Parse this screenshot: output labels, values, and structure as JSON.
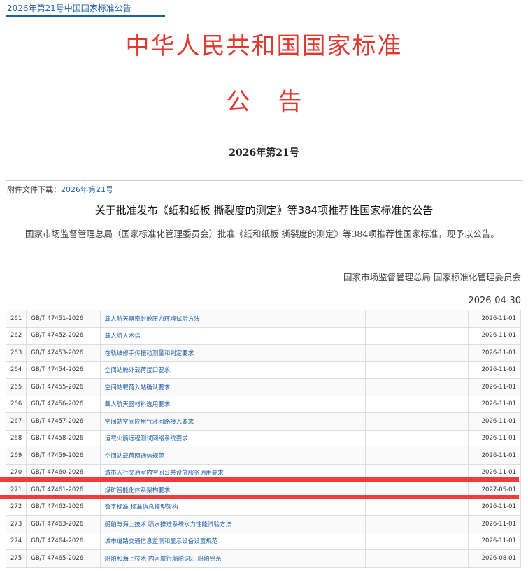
{
  "breadcrumb": "2026年第21号中国国家标准公告",
  "header": {
    "title": "中华人民共和国国家标准",
    "subtitle": "公告",
    "issue": "2026年第21号"
  },
  "attachment": {
    "label": "附件文件下载：",
    "link": "2026年第21号"
  },
  "notice": {
    "title": "关于批准发布《纸和纸板 撕裂度的测定》等384项推荐性国家标准的公告",
    "body": "国家市场监督管理总局（国家标准化管理委员会）批准《纸和纸板 撕裂度的测定》等384项推荐性国家标准，现予以公告。",
    "signature": "国家市场监督管理总局 国家标准化管理委员会",
    "date": "2026-04-30"
  },
  "rows": [
    {
      "num": "261",
      "code": "GB/T 47451-2026",
      "name": "载人航天器密封舱压力环境试验方法",
      "date": "2026-11-01"
    },
    {
      "num": "262",
      "code": "GB/T 47452-2026",
      "name": "载人航天术语",
      "date": "2026-11-01"
    },
    {
      "num": "263",
      "code": "GB/T 47453-2026",
      "name": "在轨维修手传振动测量和判定要求",
      "date": "2026-11-01"
    },
    {
      "num": "264",
      "code": "GB/T 47454-2026",
      "name": "空间站舱外载荷接口要求",
      "date": "2026-11-01"
    },
    {
      "num": "265",
      "code": "GB/T 47455-2026",
      "name": "空间站载荷入站确认要求",
      "date": "2026-11-01"
    },
    {
      "num": "266",
      "code": "GB/T 47456-2026",
      "name": "载人航天器材料选用要求",
      "date": "2026-11-01"
    },
    {
      "num": "267",
      "code": "GB/T 47457-2026",
      "name": "空间站空间应用气液回路接入要求",
      "date": "2026-11-01"
    },
    {
      "num": "268",
      "code": "GB/T 47458-2026",
      "name": "运载火箭远程测试网络系统要求",
      "date": "2026-11-01"
    },
    {
      "num": "269",
      "code": "GB/T 47459-2026",
      "name": "空间站载荷网通信规范",
      "date": "2026-11-01"
    },
    {
      "num": "270",
      "code": "GB/T 47460-2026",
      "name": "城市人行交通室内空间公共设施服务通用要求",
      "date": "2026-11-01"
    },
    {
      "num": "271",
      "code": "GB/T 47461-2026",
      "name": "煤矿智能化体系架构要求",
      "date": "2027-05-01"
    },
    {
      "num": "272",
      "code": "GB/T 47462-2026",
      "name": "数字标准 标准信息模型架构",
      "date": "2026-11-01"
    },
    {
      "num": "273",
      "code": "GB/T 47463-2026",
      "name": "船舶与海上技术 喷水推进系统水力性能试验方法",
      "date": "2026-11-01"
    },
    {
      "num": "274",
      "code": "GB/T 47464-2026",
      "name": "城市道路交通信息监测和显示设备设置规范",
      "date": "2026-11-01"
    },
    {
      "num": "275",
      "code": "GB/T 47465-2026",
      "name": "船舶和海上技术 内河航行船舶词汇 船舶铭系",
      "date": "2026-08-01"
    }
  ]
}
